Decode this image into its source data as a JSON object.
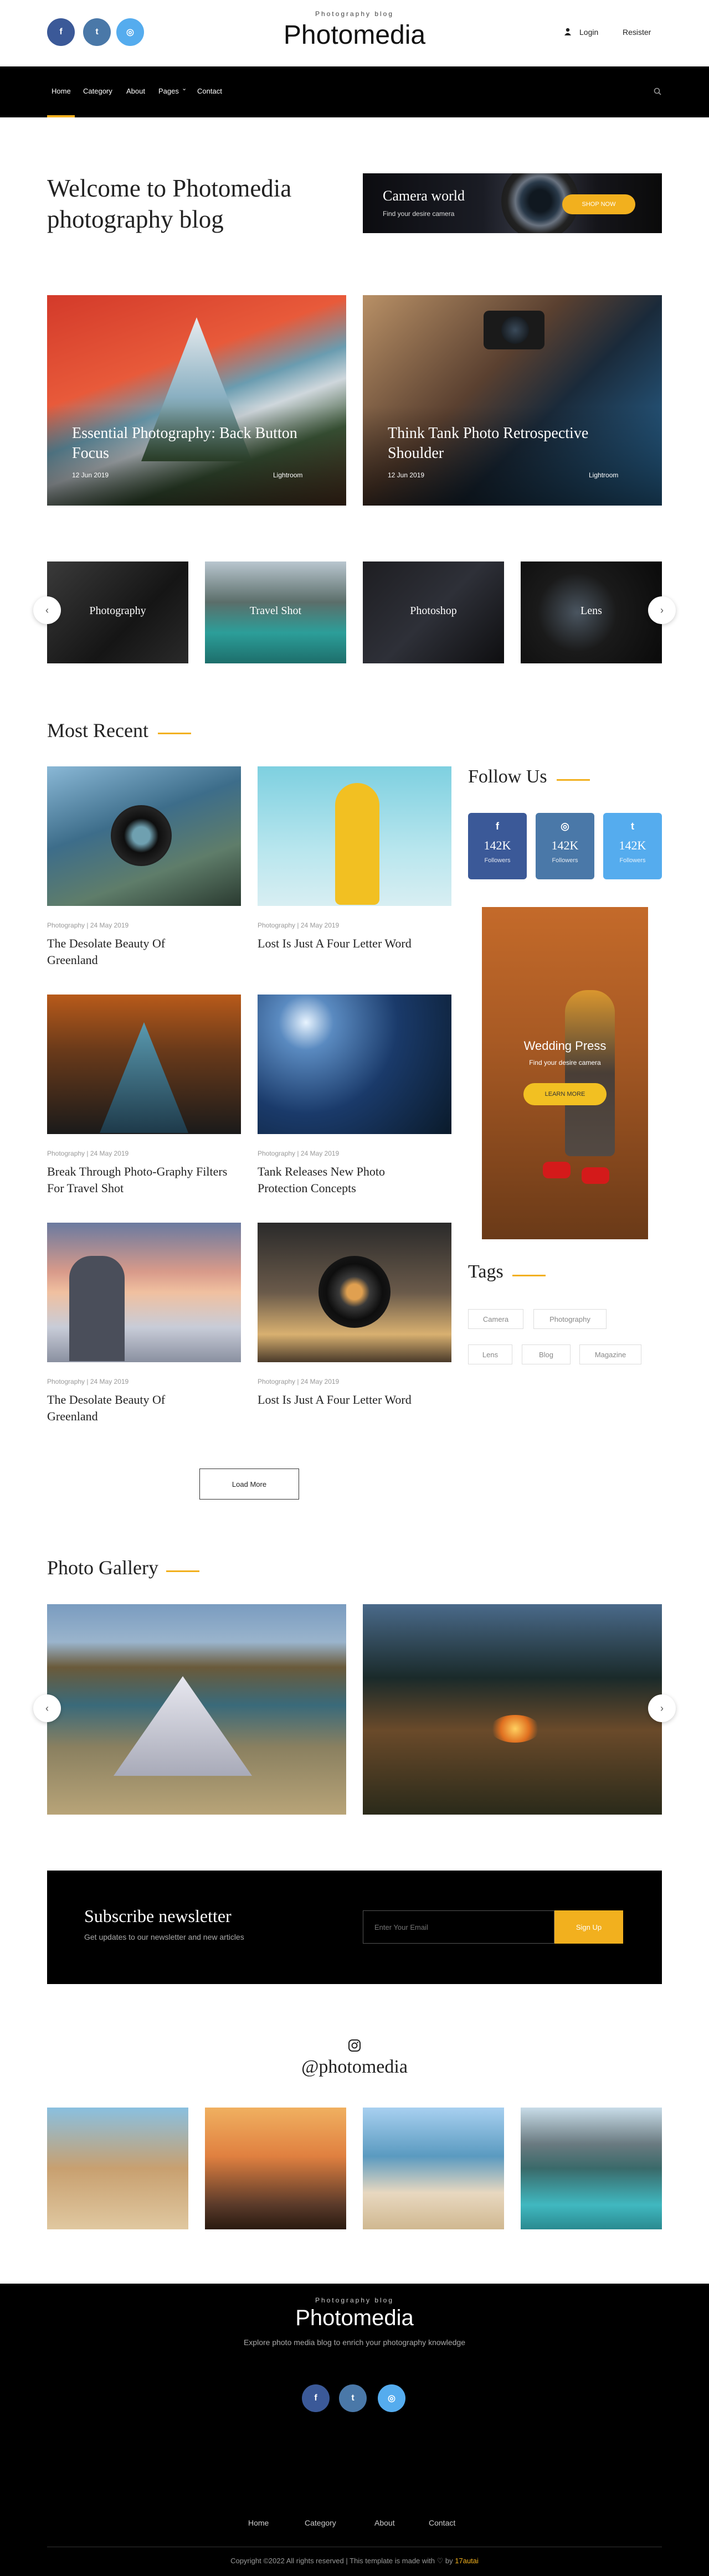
{
  "header": {
    "tagline": "Photography blog",
    "logo": "Photomedia",
    "login": "Login",
    "register": "Resister",
    "social": [
      "facebook-icon",
      "twitter-icon",
      "instagram-icon"
    ]
  },
  "nav": {
    "items": [
      "Home",
      "Category",
      "About",
      "Pages",
      "Contact"
    ],
    "pages_caret": "⌄"
  },
  "hero": {
    "title_line1": "Welcome to Photomedia",
    "title_line2": "photography blog",
    "banner": {
      "title": "Camera world",
      "subtitle": "Find your desire camera",
      "button": "SHOP NOW"
    }
  },
  "featured": [
    {
      "title": "Essential Photography: Back Button Focus",
      "date": "12 Jun 2019",
      "category": "Lightroom"
    },
    {
      "title": "Think Tank Photo Retrospective Shoulder",
      "date": "12 Jun 2019",
      "category": "Lightroom"
    }
  ],
  "categories": [
    "Photography",
    "Travel Shot",
    "Photoshop",
    "Lens"
  ],
  "most_recent": {
    "heading": "Most Recent",
    "posts": [
      {
        "meta": "Photography | 24 May 2019",
        "title": "The Desolate Beauty Of Greenland"
      },
      {
        "meta": "Photography | 24 May 2019",
        "title": "Lost Is Just A Four Letter Word"
      },
      {
        "meta": "Photography | 24 May 2019",
        "title": "Break Through Photo-Graphy Filters For Travel Shot"
      },
      {
        "meta": "Photography | 24 May 2019",
        "title": "Tank Releases New Photo Protection Concepts"
      },
      {
        "meta": "Photography | 24 May 2019",
        "title": "The Desolate Beauty Of Greenland"
      },
      {
        "meta": "Photography | 24 May 2019",
        "title": "Lost Is Just A Four Letter Word"
      }
    ],
    "load_more": "Load More"
  },
  "follow": {
    "heading": "Follow Us",
    "items": [
      {
        "icon": "facebook-icon",
        "glyph": "f",
        "count": "142K",
        "label": "Followers",
        "color": "#3b5998"
      },
      {
        "icon": "instagram-icon",
        "glyph": "◎",
        "count": "142K",
        "label": "Followers",
        "color": "#4a78a8"
      },
      {
        "icon": "twitter-icon",
        "glyph": "t",
        "count": "142K",
        "label": "Followers",
        "color": "#55acee"
      }
    ]
  },
  "ad": {
    "title": "Wedding Press",
    "subtitle": "Find your desire camera",
    "button": "LEARN MORE"
  },
  "tags": {
    "heading": "Tags",
    "items": [
      "Camera",
      "Photography",
      "Lens",
      "Blog",
      "Magazine"
    ]
  },
  "gallery": {
    "heading": "Photo Gallery"
  },
  "newsletter": {
    "title": "Subscribe newsletter",
    "subtitle": "Get updates to our newsletter and new articles",
    "placeholder": "Enter Your Email",
    "button": "Sign Up"
  },
  "instagram": {
    "handle": "@photomedia"
  },
  "footer": {
    "tagline": "Photography blog",
    "logo": "Photomedia",
    "description": "Explore photo media blog to enrich your photography knowledge",
    "links": [
      "Home",
      "Category",
      "About",
      "Contact"
    ],
    "copyright": "Copyright ©2022 All rights reserved | This template is made with ♡ by",
    "brand": "17autai"
  },
  "colors": {
    "accent": "#f2b01e",
    "dark": "#000000"
  }
}
